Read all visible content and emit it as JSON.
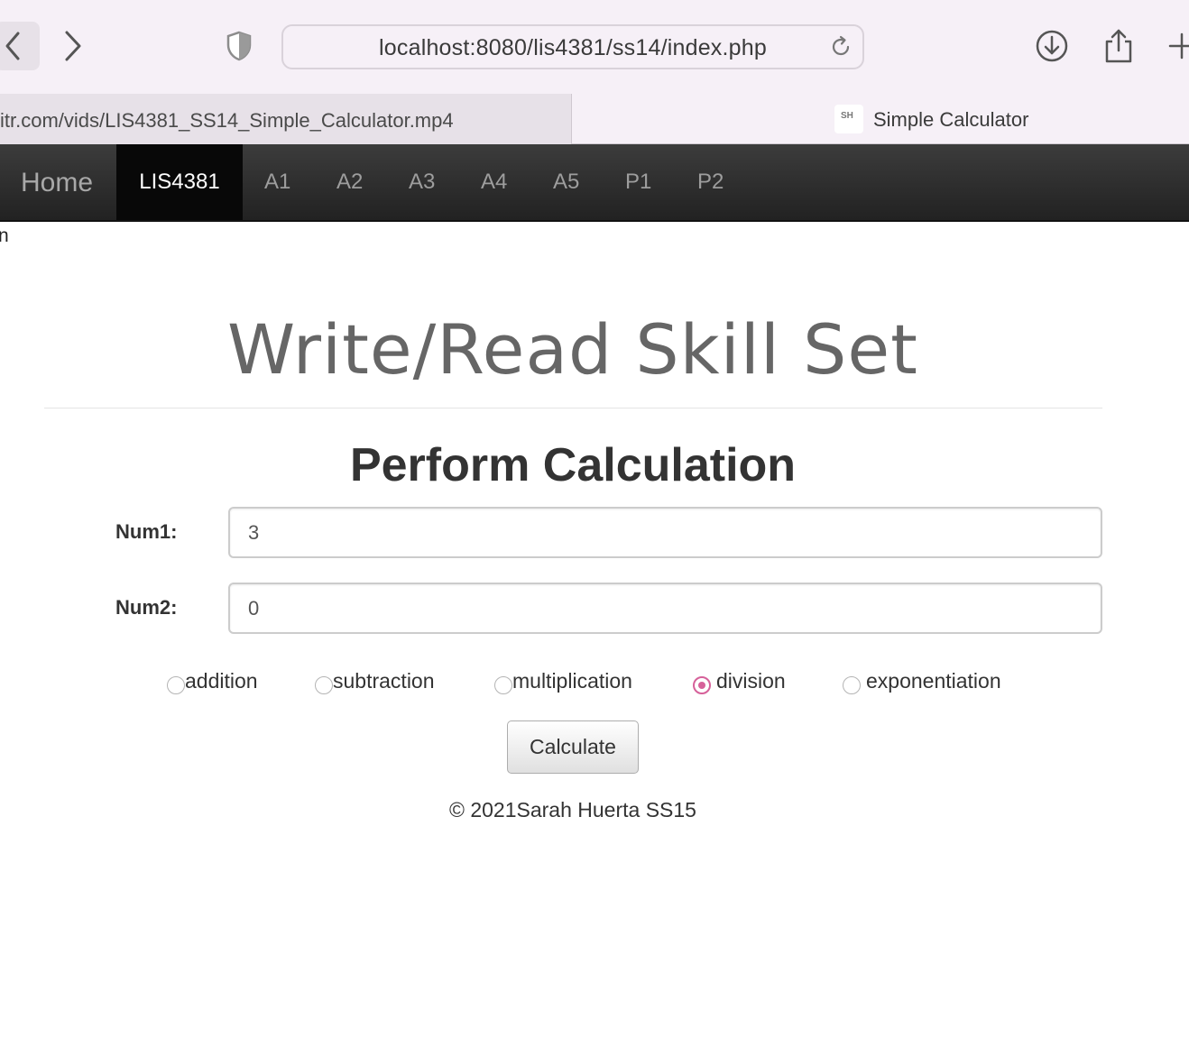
{
  "browser": {
    "url": "localhost:8080/lis4381/ss14/index.php",
    "tabs": [
      {
        "title": "itr.com/vids/LIS4381_SS14_Simple_Calculator.mp4",
        "active": false
      },
      {
        "title": "Simple Calculator",
        "active": true,
        "favicon_text": "SH"
      }
    ],
    "icons": [
      "back-icon",
      "forward-icon",
      "shield-icon",
      "reload-icon",
      "download-icon",
      "share-icon",
      "new-tab-icon"
    ]
  },
  "navbar": {
    "brand": "Home",
    "items": [
      "LIS4381",
      "A1",
      "A2",
      "A3",
      "A4",
      "A5",
      "P1",
      "P2"
    ],
    "active": "LIS4381"
  },
  "stray_text": "n",
  "main": {
    "title": "Write/Read Skill Set",
    "form_heading": "Perform Calculation",
    "fields": [
      {
        "label": "Num1:",
        "value": "3"
      },
      {
        "label": "Num2:",
        "value": "0"
      }
    ],
    "operations": [
      "addition",
      "subtraction",
      "multiplication",
      "division",
      "exponentiation"
    ],
    "selected_operation": "division",
    "submit_label": "Calculate",
    "footer": "© 2021Sarah Huerta SS15"
  },
  "colors": {
    "navbar_bg": "#222222",
    "nav_active_bg": "#080808",
    "radio_accent": "#d6619a",
    "title_gray": "#666666",
    "browser_chrome": "#f6f0f7"
  }
}
